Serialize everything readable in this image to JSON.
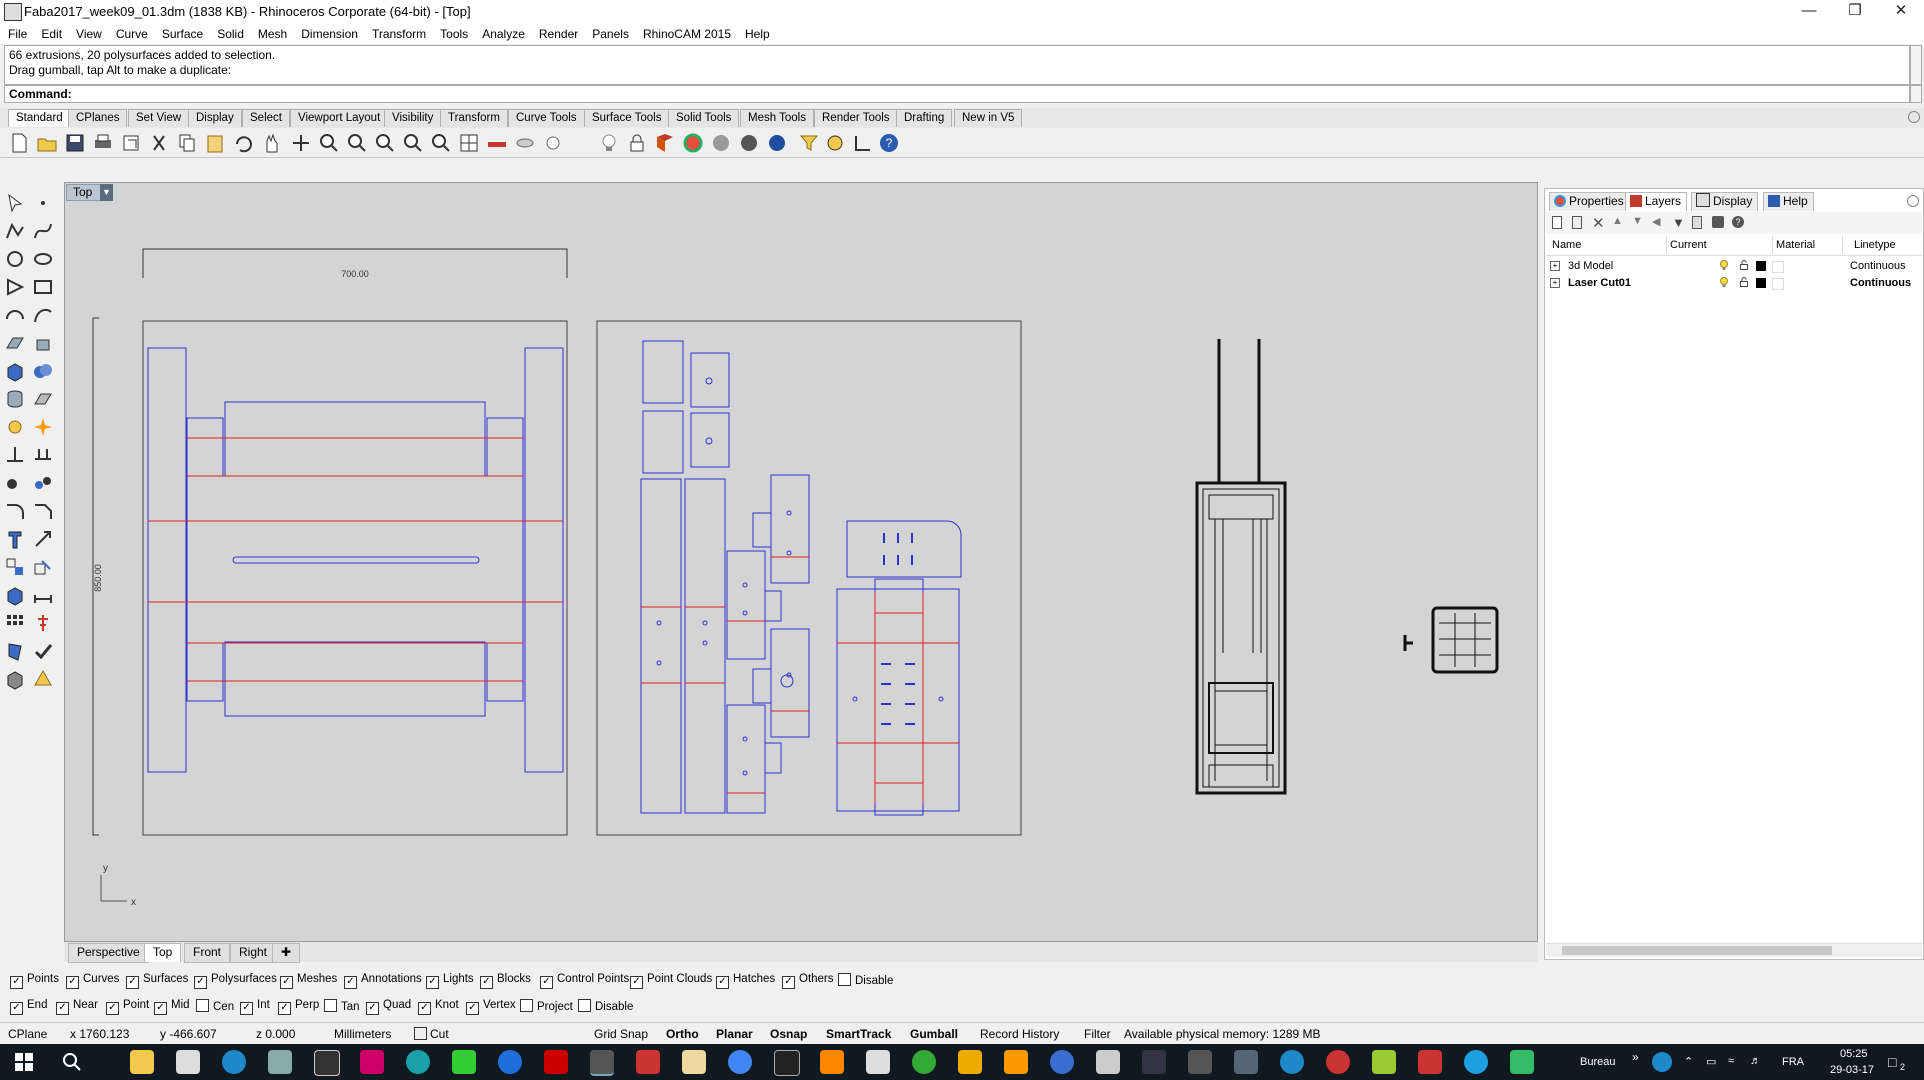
{
  "window": {
    "title": "Faba2017_week09_01.3dm (1838 KB) - Rhinoceros Corporate (64-bit) - [Top]",
    "controls": [
      "minimize",
      "restore",
      "close"
    ]
  },
  "menu": [
    "File",
    "Edit",
    "View",
    "Curve",
    "Surface",
    "Solid",
    "Mesh",
    "Dimension",
    "Transform",
    "Tools",
    "Analyze",
    "Render",
    "Panels",
    "RhinoCAM 2015",
    "Help"
  ],
  "command": {
    "history": [
      "66 extrusions, 20 polysurfaces added to selection.",
      "Drag gumball, tap Alt to make a duplicate:"
    ],
    "prompt": "Command:"
  },
  "toolbar_tabs": [
    "Standard",
    "CPlanes",
    "Set View",
    "Display",
    "Select",
    "Viewport Layout",
    "Visibility",
    "Transform",
    "Curve Tools",
    "Surface Tools",
    "Solid Tools",
    "Mesh Tools",
    "Render Tools",
    "Drafting",
    "New in V5"
  ],
  "toolbar_icons": [
    "new-icon",
    "open-icon",
    "save-icon",
    "print-icon",
    "import-icon",
    "cut-icon",
    "copy-icon",
    "paste-icon",
    "undo-icon",
    "pan-icon",
    "rotate-icon",
    "zoom-icon",
    "zoom-window-icon",
    "zoom-extents-icon",
    "zoom-selected-icon",
    "zoom-dynamic-icon",
    "viewport-grid-icon",
    "car-icon",
    "hide-icon",
    "show-icon",
    "lightbulb-icon",
    "lock-icon",
    "render-icon",
    "color-wheel-icon",
    "shaded-icon",
    "rendered-icon",
    "sphere-icon",
    "filter-icon",
    "options-icon",
    "snap-icon",
    "help-icon"
  ],
  "viewport": {
    "label": "Top",
    "dimension_top": "700.00",
    "dimension_left": "850.00",
    "axis_x": "x",
    "axis_y": "y",
    "tabs": [
      "Perspective",
      "Top",
      "Front",
      "Right"
    ],
    "active_tab": "Top"
  },
  "panel": {
    "tabs": [
      "Properties",
      "Layers",
      "Display",
      "Help"
    ],
    "active_tab": "Layers",
    "columns": [
      "Name",
      "Current",
      "Material",
      "Linetype"
    ],
    "layers": [
      {
        "name": "3d Model",
        "linetype": "Continuous",
        "current": false
      },
      {
        "name": "Laser Cut01",
        "linetype": "Continuous",
        "current": true
      }
    ]
  },
  "filters": [
    {
      "label": "Points",
      "checked": true
    },
    {
      "label": "Curves",
      "checked": true
    },
    {
      "label": "Surfaces",
      "checked": true
    },
    {
      "label": "Polysurfaces",
      "checked": true
    },
    {
      "label": "Meshes",
      "checked": true
    },
    {
      "label": "Annotations",
      "checked": true
    },
    {
      "label": "Lights",
      "checked": true
    },
    {
      "label": "Blocks",
      "checked": true
    },
    {
      "label": "Control Points",
      "checked": true
    },
    {
      "label": "Point Clouds",
      "checked": true
    },
    {
      "label": "Hatches",
      "checked": true
    },
    {
      "label": "Others",
      "checked": true
    },
    {
      "label": "Disable",
      "checked": false
    }
  ],
  "osnaps": [
    {
      "label": "End",
      "checked": true
    },
    {
      "label": "Near",
      "checked": true
    },
    {
      "label": "Point",
      "checked": true
    },
    {
      "label": "Mid",
      "checked": true
    },
    {
      "label": "Cen",
      "checked": false
    },
    {
      "label": "Int",
      "checked": true
    },
    {
      "label": "Perp",
      "checked": true
    },
    {
      "label": "Tan",
      "checked": false
    },
    {
      "label": "Quad",
      "checked": true
    },
    {
      "label": "Knot",
      "checked": true
    },
    {
      "label": "Vertex",
      "checked": true
    },
    {
      "label": "Project",
      "checked": false
    },
    {
      "label": "Disable",
      "checked": false
    }
  ],
  "status": {
    "cplane": "CPlane",
    "x": "x 1760.123",
    "y": "y -466.607",
    "z": "z 0.000",
    "units": "Millimeters",
    "layer": "Cut",
    "grid_snap": "Grid Snap",
    "ortho": "Ortho",
    "planar": "Planar",
    "osnap": "Osnap",
    "smarttrack": "SmartTrack",
    "gumball": "Gumball",
    "record_history": "Record History",
    "filter": "Filter",
    "memory": "Available physical memory: 1289 MB"
  },
  "taskbar": {
    "desktop_label": "Bureau",
    "language": "FRA",
    "time": "05:25",
    "date": "29-03-17",
    "notifications": "2"
  },
  "colors": {
    "outline_blue": "#3030d0",
    "cut_red": "#e02020",
    "viewport_bg": "#d4d4d4",
    "taskbar_bg": "#101820"
  }
}
